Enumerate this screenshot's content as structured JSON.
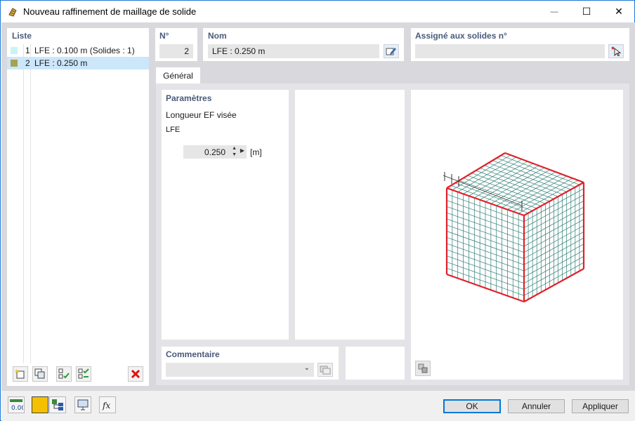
{
  "window": {
    "title": "Nouveau raffinement de maillage de solide",
    "minimize_symbol": "—",
    "maximize_symbol": "☐",
    "close_symbol": "✕"
  },
  "list": {
    "label": "Liste",
    "items": [
      {
        "num": "1",
        "text": "LFE : 0.100 m (Solides : 1)",
        "color": "#c9f4f4",
        "selected": false
      },
      {
        "num": "2",
        "text": "LFE : 0.250 m",
        "color": "#a6a24f",
        "selected": true
      }
    ]
  },
  "number": {
    "label": "N°",
    "value": "2"
  },
  "name": {
    "label": "Nom",
    "value": "LFE : 0.250 m"
  },
  "assigned": {
    "label": "Assigné aux solides n°",
    "value": ""
  },
  "tabs": [
    {
      "label": "Général",
      "active": true
    }
  ],
  "parameters": {
    "label": "Paramètres",
    "target_length_label": "Longueur EF visée",
    "symbol": "LFE",
    "value": "0.250",
    "unit": "[m]"
  },
  "comment": {
    "label": "Commentaire",
    "value": ""
  },
  "buttons": {
    "ok": "OK",
    "cancel": "Annuler",
    "apply": "Appliquer"
  },
  "icons": {
    "app": "mesh-refinement-icon",
    "units": "decimal-places-icon",
    "color": "color-picker-icon"
  },
  "accent_colors": {
    "edge": "#e0202a",
    "mesh": "#2e7d74",
    "delete": "#e01010"
  }
}
